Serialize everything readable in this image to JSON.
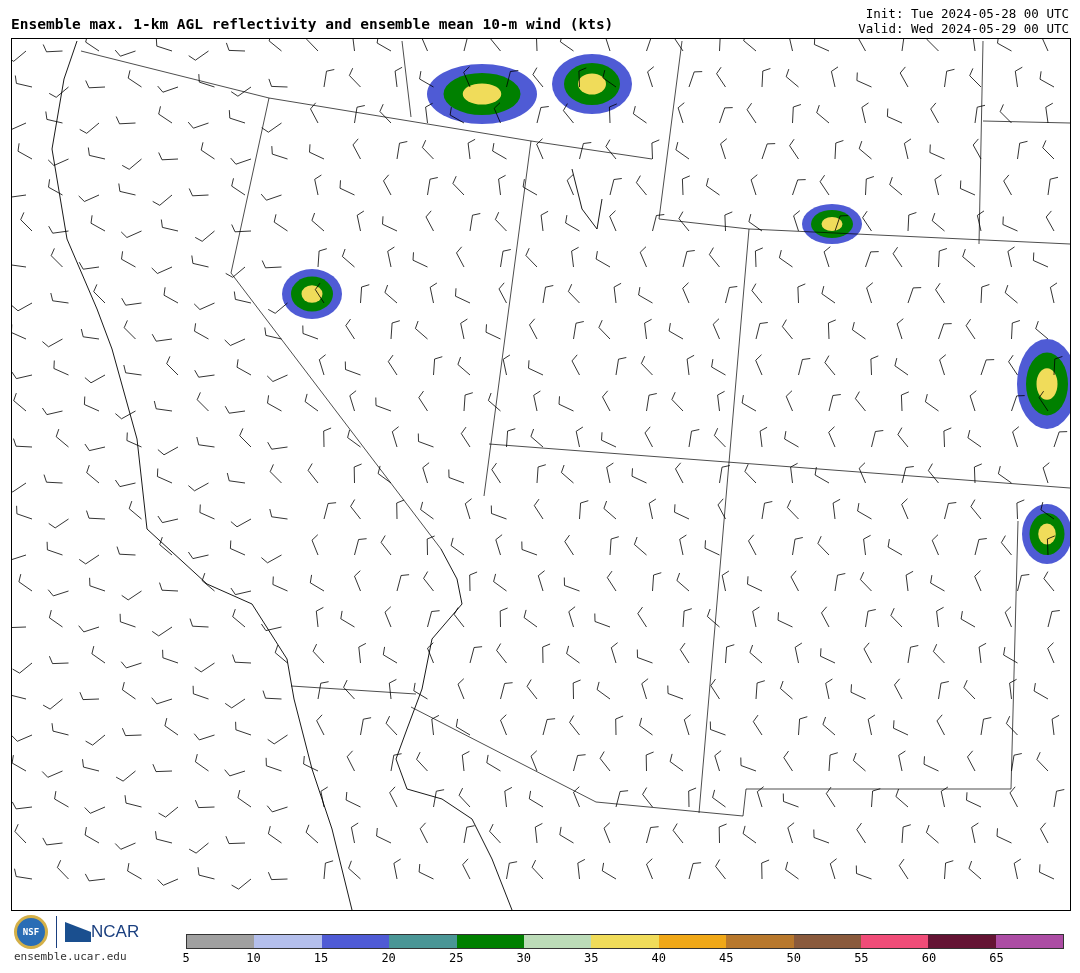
{
  "title": "Ensemble max. 1-km AGL reflectivity and ensemble mean 10-m wind (kts)",
  "init": "Init: Tue 2024-05-28 00 UTC",
  "valid": "Valid: Wed 2024-05-29 00 UTC",
  "logos": {
    "nsf": "NSF",
    "ncar": "NCAR",
    "site": "ensemble.ucar.edu"
  },
  "colorbar": {
    "colors": [
      {
        "color": "#a0a0a0"
      },
      {
        "color": "#b4bfec"
      },
      {
        "color": "#4f5bd5"
      },
      {
        "color": "#4a9696"
      },
      {
        "color": "#008000"
      },
      {
        "color": "#bcdcb8"
      },
      {
        "color": "#f0dc5a"
      },
      {
        "color": "#f0a818"
      },
      {
        "color": "#b8782c"
      },
      {
        "color": "#8a5a3c"
      },
      {
        "color": "#f04c78"
      },
      {
        "color": "#641434"
      },
      {
        "color": "#ac4ca4"
      }
    ],
    "ticks": [
      "5",
      "10",
      "15",
      "20",
      "25",
      "30",
      "35",
      "40",
      "45",
      "50",
      "55",
      "60",
      "65"
    ]
  }
}
